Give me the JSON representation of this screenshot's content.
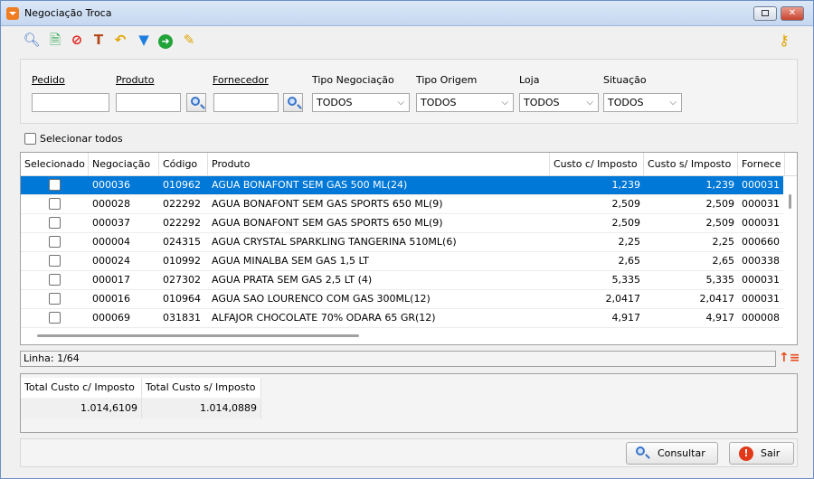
{
  "window": {
    "title": "Negociação Troca"
  },
  "toolbar": {
    "icons": [
      "search-icon",
      "new-document-icon",
      "cancel-icon",
      "tools-icon",
      "undo-icon",
      "filter-icon",
      "go-icon",
      "edit-icon"
    ]
  },
  "filters": {
    "pedido_label": "Pedido",
    "produto_label": "Produto",
    "fornecedor_label": "Fornecedor",
    "tipo_negociacao_label": "Tipo Negociação",
    "tipo_negociacao_value": "TODOS",
    "tipo_origem_label": "Tipo Origem",
    "tipo_origem_value": "TODOS",
    "loja_label": "Loja",
    "loja_value": "TODOS",
    "situacao_label": "Situação",
    "situacao_value": "TODOS"
  },
  "select_all_label": "Selecionar todos",
  "grid": {
    "headers": [
      "Selecionado",
      "Negociação",
      "Código",
      "Produto",
      "Custo c/ Imposto",
      "Custo s/ Imposto",
      "Fornece"
    ],
    "rows": [
      {
        "neg": "000036",
        "cod": "010962",
        "prod": "AGUA BONAFONT SEM GAS 500 ML(24)",
        "cc": "1,239",
        "cs": "1,239",
        "forn": "000031"
      },
      {
        "neg": "000028",
        "cod": "022292",
        "prod": "AGUA BONAFONT SEM GAS SPORTS 650 ML(9)",
        "cc": "2,509",
        "cs": "2,509",
        "forn": "000031"
      },
      {
        "neg": "000037",
        "cod": "022292",
        "prod": "AGUA BONAFONT SEM GAS SPORTS 650 ML(9)",
        "cc": "2,509",
        "cs": "2,509",
        "forn": "000031"
      },
      {
        "neg": "000004",
        "cod": "024315",
        "prod": "AGUA CRYSTAL SPARKLING TANGERINA 510ML(6)",
        "cc": "2,25",
        "cs": "2,25",
        "forn": "000660"
      },
      {
        "neg": "000024",
        "cod": "010992",
        "prod": "AGUA MINALBA SEM GAS 1,5 LT",
        "cc": "2,65",
        "cs": "2,65",
        "forn": "000338"
      },
      {
        "neg": "000017",
        "cod": "027302",
        "prod": "AGUA PRATA SEM GAS 2,5 LT (4)",
        "cc": "5,335",
        "cs": "5,335",
        "forn": "000031"
      },
      {
        "neg": "000016",
        "cod": "010964",
        "prod": "AGUA SAO LOURENCO COM GAS 300ML(12)",
        "cc": "2,0417",
        "cs": "2,0417",
        "forn": "000031"
      },
      {
        "neg": "000069",
        "cod": "031831",
        "prod": "ALFAJOR CHOCOLATE 70%  ODARA  65 GR(12)",
        "cc": "4,917",
        "cs": "4,917",
        "forn": "000008"
      }
    ]
  },
  "status": {
    "linha": "Linha: 1/64"
  },
  "totals": {
    "custo_c_label": "Total Custo c/ Imposto",
    "custo_s_label": "Total Custo s/ Imposto",
    "custo_c_value": "1.014,6109",
    "custo_s_value": "1.014,0889"
  },
  "footer": {
    "consultar_label": "Consultar",
    "sair_label": "Sair"
  },
  "colors": {
    "selection": "#0078d7",
    "accent_orange": "#ef7d22",
    "exit_red": "#e03818"
  }
}
